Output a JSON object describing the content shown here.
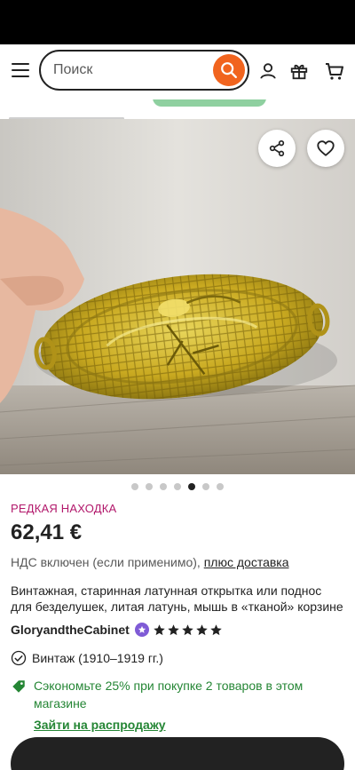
{
  "header": {
    "search": {
      "placeholder": "Поиск",
      "value": ""
    },
    "icons": [
      "menu-icon",
      "search-icon",
      "user-icon",
      "gift-icon",
      "cart-icon"
    ]
  },
  "gallery": {
    "total_images": 7,
    "active_index": 4,
    "actions": [
      "share-icon",
      "heart-icon"
    ]
  },
  "product": {
    "badge": "РЕДКАЯ НАХОДКА",
    "price": "62,41 €",
    "vat_text": "НДС включен (если применимо),",
    "shipping_link": "плюс доставка",
    "title": "Винтажная, старинная латунная открытка или поднос для безделушек, литая латунь, мышь в «тканой» корзине",
    "shop_name": "GloryandtheCabinet",
    "rating_stars": 5,
    "vintage": "Винтаж (1910–1919 гг.)",
    "sale_text": "Сэкономьте 25% при покупке 2 товаров в этом магазине",
    "sale_link": "Зайти на распродажу"
  },
  "colors": {
    "accent_orange": "#f1641e",
    "rare_pink": "#b2186b",
    "sale_green": "#258635",
    "star_seller_purple": "#7f5bd6"
  }
}
